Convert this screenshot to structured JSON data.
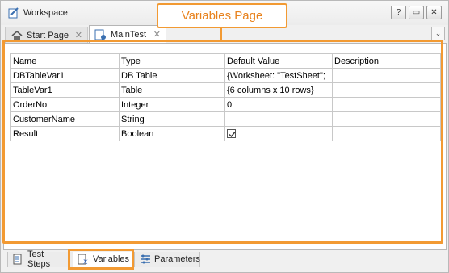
{
  "window": {
    "title": "Workspace"
  },
  "window_buttons": [
    "?",
    "▭",
    "✕"
  ],
  "callout": {
    "label": "Variables Page",
    "color": "#f29a33"
  },
  "tabs": [
    {
      "label": "Start Page",
      "close": "✕"
    },
    {
      "label": "MainTest",
      "close": "✕"
    }
  ],
  "tab_menu": "⌄",
  "table": {
    "headers": [
      "Name",
      "Type",
      "Default Value",
      "Description"
    ],
    "rows": [
      {
        "name": "DBTableVar1",
        "type": "DB Table",
        "default": "{Worksheet: \"TestSheet\";",
        "description": ""
      },
      {
        "name": "TableVar1",
        "type": "Table",
        "default": "{6 columns x 10 rows}",
        "description": ""
      },
      {
        "name": "OrderNo",
        "type": "Integer",
        "default": "0",
        "description": ""
      },
      {
        "name": "CustomerName",
        "type": "String",
        "default": "",
        "description": ""
      },
      {
        "name": "Result",
        "type": "Boolean",
        "default": "checked",
        "description": ""
      }
    ]
  },
  "bottom_tabs": [
    {
      "label": "Test Steps"
    },
    {
      "label": "Variables"
    },
    {
      "label": "Parameters"
    }
  ]
}
